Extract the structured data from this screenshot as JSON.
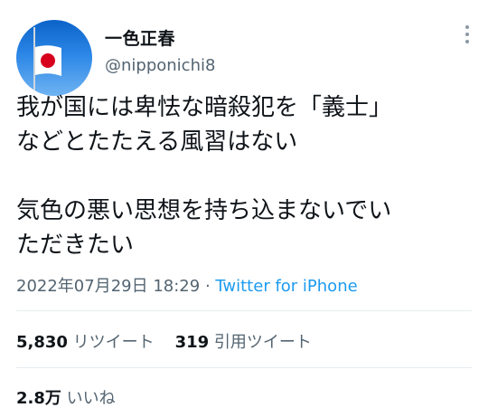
{
  "author": {
    "display_name": "一色正春",
    "handle": "@nipponichi8",
    "avatar_icon": "japan-flag-avatar-icon"
  },
  "more_icon": "more-options-icon",
  "tweet": {
    "lines": [
      "我が国には卑怯な暗殺犯を「義士」",
      "などとたたえる風習はない",
      "",
      "気色の悪い思想を持ち込まないでい",
      "ただきたい"
    ]
  },
  "meta": {
    "timestamp": "2022年07月29日 18:29",
    "separator": " · ",
    "source": "Twitter for iPhone"
  },
  "stats": {
    "retweets_count": "5,830",
    "retweets_label": "リツイート",
    "quotes_count": "319",
    "quotes_label": "引用ツイート",
    "likes_count": "2.8万",
    "likes_label": "いいね"
  },
  "colors": {
    "text": "#0f1419",
    "secondary": "#536471",
    "link": "#1d9bf0",
    "sky": "#2b86e6",
    "flag_red": "#d7001d"
  }
}
